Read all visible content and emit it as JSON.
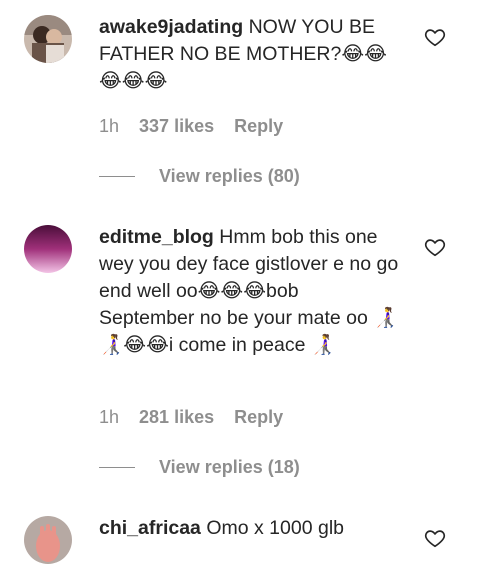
{
  "comments": [
    {
      "username": "awake9jadating",
      "text": "NOW YOU BE FATHER NO BE MOTHER?😂😂😂😂😂",
      "time": "1h",
      "likes": "337 likes",
      "reply_label": "Reply",
      "view_replies": "View replies (80)",
      "avatar_icon": "couple-photo-avatar"
    },
    {
      "username": "editme_blog",
      "text": "Hmm bob this one wey you dey face gistlover e no go end well oo😂😂😂bob September no be your mate oo 👩‍🦯👩‍🦯😂😂i come in peace 👩‍🦯",
      "time": "1h",
      "likes": "281 likes",
      "reply_label": "Reply",
      "view_replies": "View replies (18)",
      "avatar_icon": "pink-gradient-avatar"
    },
    {
      "username": "chi_africaa",
      "text": "Omo x 1000 glb",
      "avatar_icon": "hand-photo-avatar"
    }
  ],
  "icons": {
    "heart": "heart-outline-icon"
  },
  "colors": {
    "text": "#262626",
    "muted": "#8e8e8e"
  }
}
